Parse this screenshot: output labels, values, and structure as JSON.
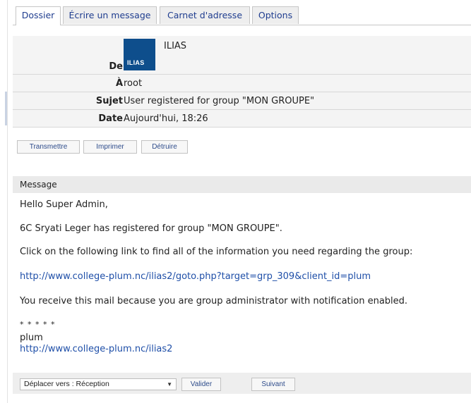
{
  "tabs": [
    {
      "label": "Dossier",
      "active": true
    },
    {
      "label": "Écrire un message",
      "active": false
    },
    {
      "label": "Carnet d'adresse",
      "active": false
    },
    {
      "label": "Options",
      "active": false
    }
  ],
  "header": {
    "from_label": "De",
    "from_value": "ILIAS",
    "logo_text": "ILIAS",
    "to_label": "À",
    "to_value": "root",
    "subject_label": "Sujet",
    "subject_value": "User registered for group \"MON GROUPE\"",
    "date_label": "Date",
    "date_value": "Aujourd'hui, 18:26"
  },
  "actions": {
    "forward": "Transmettre",
    "print": "Imprimer",
    "delete": "Détruire"
  },
  "message": {
    "heading": "Message",
    "greeting": "Hello Super Admin,",
    "line1": "6C Sryati Leger has registered for group \"MON GROUPE\".",
    "line2": "Click on the following link to find all of the information you need regarding the group:",
    "link": "http://www.college-plum.nc/ilias2/goto.php?target=grp_309&client_id=plum",
    "line3": "You receive this mail because you are group administrator with notification enabled.",
    "stars": "* * * * *",
    "signature": "plum",
    "signature_link": "http://www.college-plum.nc/ilias2"
  },
  "footer": {
    "move_select": "Déplacer vers : Réception",
    "validate": "Valider",
    "next": "Suivant"
  },
  "colors": {
    "link": "#1f4fa8",
    "tab_text": "#1f3d8f",
    "logo_bg": "#0e4e8c"
  }
}
